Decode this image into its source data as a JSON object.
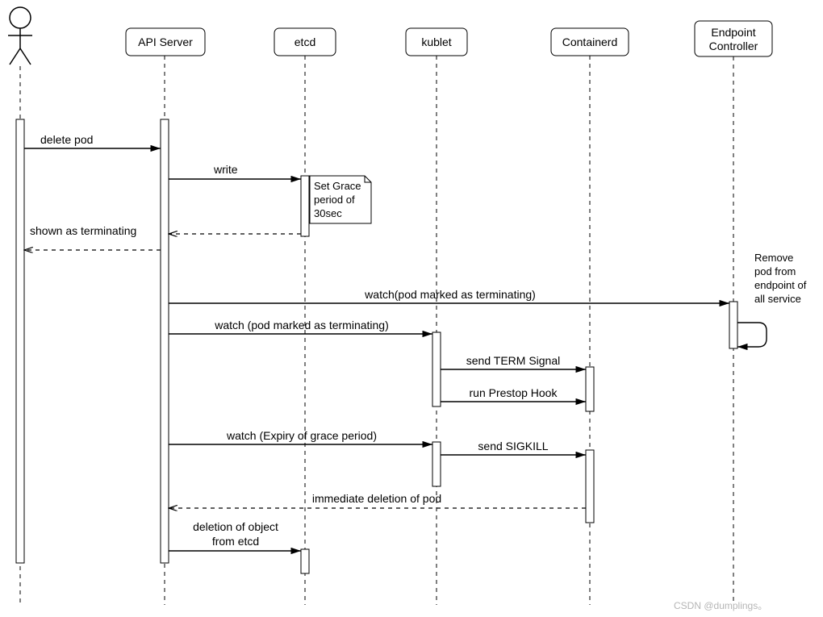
{
  "participants": {
    "api_server": "API Server",
    "etcd": "etcd",
    "kublet": "kublet",
    "containerd": "Containerd",
    "endpoint_controller_l1": "Endpoint",
    "endpoint_controller_l2": "Controller"
  },
  "notes": {
    "grace_l1": "Set Grace",
    "grace_l2": "period of",
    "grace_l3": "30sec",
    "remove_l1": "Remove",
    "remove_l2": "pod from",
    "remove_l3": "endpoint of",
    "remove_l4": "all service"
  },
  "messages": {
    "delete_pod": "delete pod",
    "write": "write",
    "terminating": "shown as terminating",
    "watch_ep": "watch(pod marked as terminating)",
    "watch_kublet": "watch (pod marked as terminating)",
    "term_signal": "send TERM Signal",
    "prestop": "run Prestop Hook",
    "watch_expiry": "watch (Expiry of grace period)",
    "sigkill": "send  SIGKILL",
    "immediate": "immediate deletion of pod",
    "del_etcd_l1": "deletion of object",
    "del_etcd_l2": "from etcd"
  },
  "watermark": "CSDN @dumplings。"
}
